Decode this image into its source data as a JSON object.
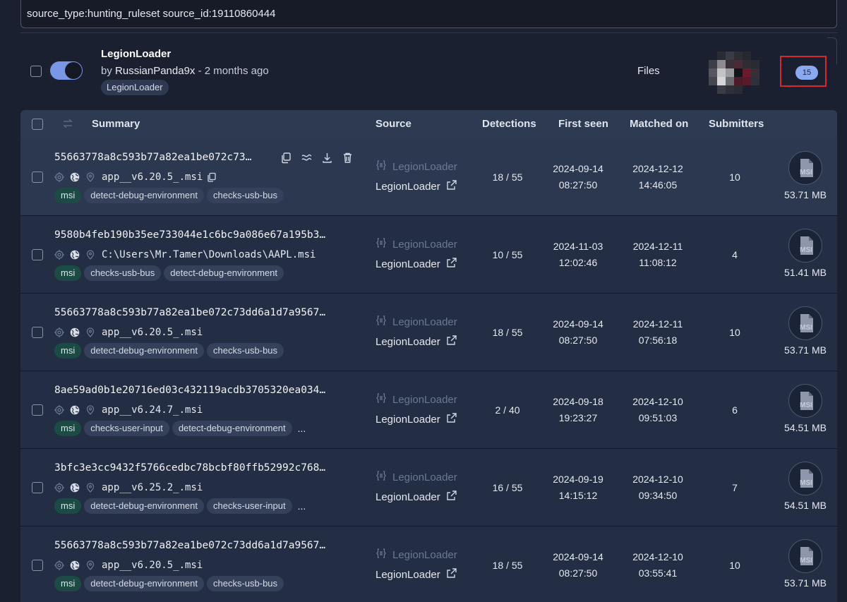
{
  "search": {
    "value": "source_type:hunting_ruleset source_id:19110860444"
  },
  "ruleset": {
    "name": "LegionLoader",
    "by_prefix": "by",
    "author": "RussianPanda9x",
    "age": "- 2 months ago",
    "tag": "LegionLoader",
    "files_label": "Files",
    "match_count": "15",
    "enabled": true
  },
  "table": {
    "headers": {
      "summary": "Summary",
      "source": "Source",
      "detections": "Detections",
      "first_seen": "First seen",
      "matched_on": "Matched on",
      "submitters": "Submitters"
    },
    "rows": [
      {
        "hash": "55663778a8c593b77a82ea1be072c73…",
        "filename": "app__v6.20.5_.msi",
        "tags": [
          "msi",
          "detect-debug-environment",
          "checks-usb-bus"
        ],
        "more": "",
        "source_rule": "LegionLoader",
        "source": "LegionLoader",
        "detections": "18 / 55",
        "first_seen_date": "2024-09-14",
        "first_seen_time": "08:27:50",
        "matched_date": "2024-12-12",
        "matched_time": "14:46:05",
        "submitters": "10",
        "file_type": "MSI",
        "size": "53.71 MB"
      },
      {
        "hash": "9580b4feb190b35ee733044e1c6bc9a086e67a195b3…",
        "filename": "C:\\Users\\Mr.Tamer\\Downloads\\AAPL.msi",
        "tags": [
          "msi",
          "checks-usb-bus",
          "detect-debug-environment"
        ],
        "more": "",
        "source_rule": "LegionLoader",
        "source": "LegionLoader",
        "detections": "10 / 55",
        "first_seen_date": "2024-11-03",
        "first_seen_time": "12:02:46",
        "matched_date": "2024-12-11",
        "matched_time": "11:08:12",
        "submitters": "4",
        "file_type": "MSI",
        "size": "51.41 MB"
      },
      {
        "hash": "55663778a8c593b77a82ea1be072c73dd6a1d7a9567…",
        "filename": "app__v6.20.5_.msi",
        "tags": [
          "msi",
          "detect-debug-environment",
          "checks-usb-bus"
        ],
        "more": "",
        "source_rule": "LegionLoader",
        "source": "LegionLoader",
        "detections": "18 / 55",
        "first_seen_date": "2024-09-14",
        "first_seen_time": "08:27:50",
        "matched_date": "2024-12-11",
        "matched_time": "07:56:18",
        "submitters": "10",
        "file_type": "MSI",
        "size": "53.71 MB"
      },
      {
        "hash": "8ae59ad0b1e20716ed03c432119acdb3705320ea034…",
        "filename": "app__v6.24.7_.msi",
        "tags": [
          "msi",
          "checks-user-input",
          "detect-debug-environment"
        ],
        "more": "...",
        "source_rule": "LegionLoader",
        "source": "LegionLoader",
        "detections": "2 / 40",
        "first_seen_date": "2024-09-18",
        "first_seen_time": "19:23:27",
        "matched_date": "2024-12-10",
        "matched_time": "09:51:03",
        "submitters": "6",
        "file_type": "MSI",
        "size": "54.51 MB"
      },
      {
        "hash": "3bfc3e3cc9432f5766cedbc78bcbf80ffb52992c768…",
        "filename": "app__v6.25.2_.msi",
        "tags": [
          "msi",
          "detect-debug-environment",
          "checks-user-input"
        ],
        "more": "...",
        "source_rule": "LegionLoader",
        "source": "LegionLoader",
        "detections": "16 / 55",
        "first_seen_date": "2024-09-19",
        "first_seen_time": "14:15:12",
        "matched_date": "2024-12-10",
        "matched_time": "09:34:50",
        "submitters": "7",
        "file_type": "MSI",
        "size": "54.51 MB"
      },
      {
        "hash": "55663778a8c593b77a82ea1be072c73dd6a1d7a9567…",
        "filename": "app__v6.20.5_.msi",
        "tags": [
          "msi",
          "detect-debug-environment",
          "checks-usb-bus"
        ],
        "more": "",
        "source_rule": "LegionLoader",
        "source": "LegionLoader",
        "detections": "18 / 55",
        "first_seen_date": "2024-09-14",
        "first_seen_time": "08:27:50",
        "matched_date": "2024-12-10",
        "matched_time": "03:55:41",
        "submitters": "10",
        "file_type": "MSI",
        "size": "53.71 MB"
      }
    ]
  },
  "colors": {
    "background": "#1b2030",
    "row": "#232d44",
    "row_hover": "#2c3850",
    "header": "#2d3a52",
    "toggle_on": "#7a96e6",
    "highlight_box": "#d9272e",
    "count_pill": "#8aa9f0",
    "type_tag": "#1c4a44"
  },
  "icons": [
    "copy-icon",
    "similar-icon",
    "download-icon",
    "delete-icon",
    "target-icon",
    "globe-icon",
    "location-pin-icon",
    "external-link-icon",
    "ruleset-icon",
    "msi-file-icon",
    "swap-icon"
  ]
}
